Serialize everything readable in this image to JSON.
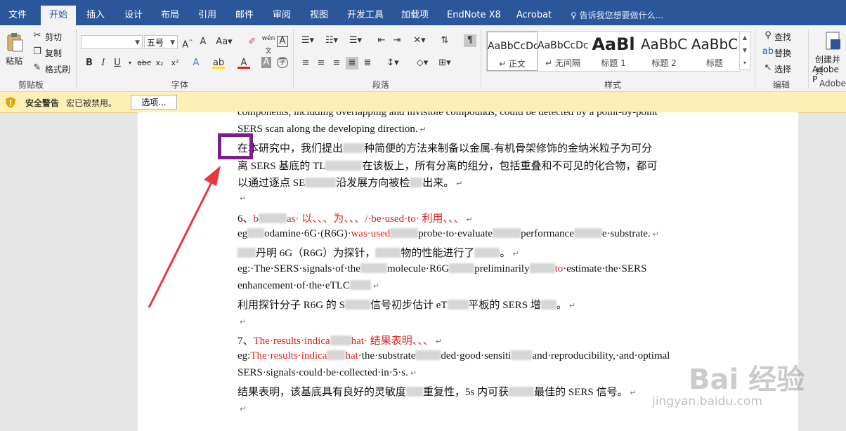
{
  "menu": {
    "tabs": [
      "文件",
      "开始",
      "插入",
      "设计",
      "布局",
      "引用",
      "邮件",
      "审阅",
      "视图",
      "开发工具",
      "加载项",
      "EndNote X8",
      "Acrobat"
    ],
    "tell_me": "告诉我您想要做什么..."
  },
  "ribbon": {
    "clipboard": {
      "paste": "粘贴",
      "cut": "剪切",
      "copy": "复制",
      "format_painter": "格式刷",
      "label": "剪贴板"
    },
    "font": {
      "font_name": "",
      "font_size": "五号",
      "label": "字体",
      "wen": "wén"
    },
    "paragraph": {
      "label": "段落"
    },
    "styles": {
      "label": "样式",
      "items": [
        {
          "sample": "AaBbCcDc",
          "name": "↵ 正文"
        },
        {
          "sample": "AaBbCcDc",
          "name": "↵ 无间隔"
        },
        {
          "sample": "AaBl",
          "name": "标题 1"
        },
        {
          "sample": "AaBbC",
          "name": "标题 2"
        },
        {
          "sample": "AaBbC",
          "name": "标题"
        }
      ]
    },
    "editing": {
      "find": "查找",
      "replace": "替换",
      "select": "选择",
      "label": "编辑"
    },
    "adobe": {
      "create": "创建并共",
      "adobe": "Adobe P",
      "label": "Adobe"
    }
  },
  "security_bar": {
    "title": "安全警告",
    "message": "宏已被禁用。",
    "button": "选项..."
  },
  "document": {
    "l1": "components, including overlapping and invisible compounds, could be detected by a point-by-point",
    "l2": "SERS scan along the developing direction.",
    "l3a": "在",
    "l3b": "本研究中，我们提出",
    "l3c": "种简便的方法来制备以金属-有机骨架修饰的金纳米粒子为可分",
    "l4a": "离 SERS 基底的 TL",
    "l4b": "在该板上，所有分离的组分，包括重叠和不可见的化合物，都可",
    "l5a": "以通过逐点 SE",
    "l5b": "沿发展方向被检",
    "l5c": "出来。",
    "h6a": "6、",
    "h6b": "b",
    "h6c": "as· 以、、、为、、、/·be·used·to· 利用、、、",
    "l7a": "eg",
    "l7b": "odamine·6G·(R6G)·",
    "l7c": "was·used",
    "l7d": "probe·to·evaluate",
    "l7e": "performance",
    "l7f": "e·substrate.",
    "l8a": "丹明 6G（R6G）为探针，",
    "l8b": "物的性能进行了",
    "l8c": "。",
    "l9a": "eg:·The·SERS·signals·of·the",
    "l9b": "molecule·R6G",
    "l9c": "preliminarily",
    "l9d": "to",
    "l9e": "·estimate·the·SERS",
    "l10": "enhancement·of·the·eTLC",
    "l11a": "利用探针分子 R6G 的 S",
    "l11b": "信号初步估计 eT",
    "l11c": "平板的 SERS 增",
    "l11d": "。",
    "h12a": "7、",
    "h12b": "The·results·indica",
    "h12c": "hat· 结果表明、、、",
    "l13a": "eg:",
    "l13b": "The·results·indica",
    "l13c": "hat",
    "l13d": "·the·substrate",
    "l13e": "ded·good·sensiti",
    "l13f": "and·reproducibility,·and·optimal",
    "l14": "SERS·signals·could·be·collected·in·5·s.",
    "l15a": "结果表明，该基底具有良好的灵敏度",
    "l15b": "重复性，5s 内可获",
    "l15c": "最佳的 SERS 信号。"
  },
  "watermark": {
    "brand": "Bai 经验",
    "url": "jingyan.baidu.com"
  }
}
